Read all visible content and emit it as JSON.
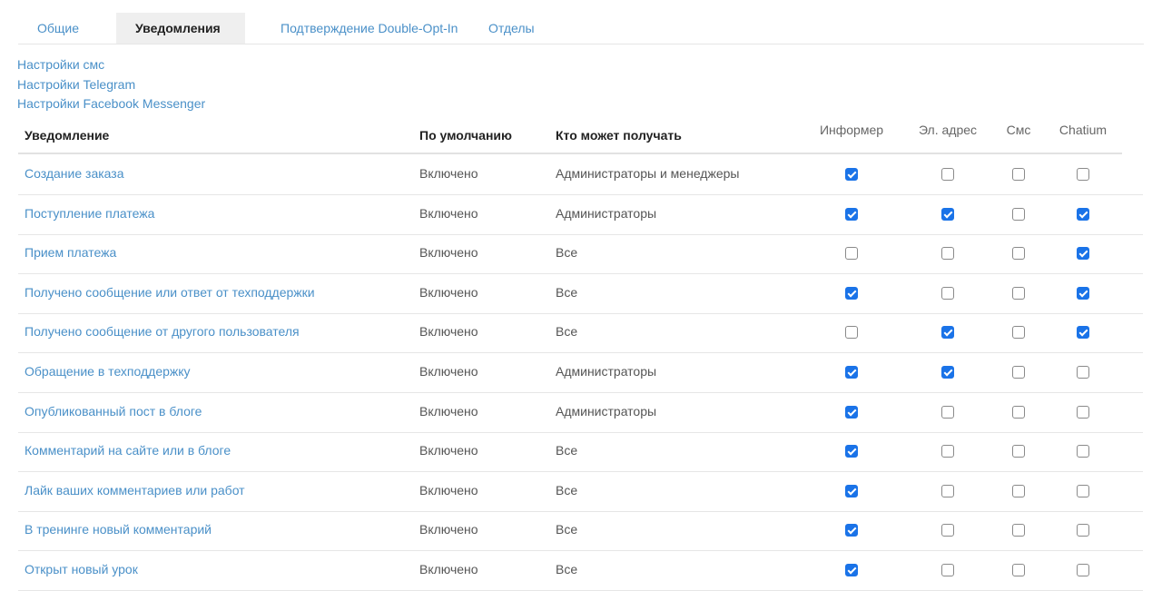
{
  "tabs": [
    {
      "label": "Общие",
      "active": false
    },
    {
      "label": "Уведомления",
      "active": true
    },
    {
      "label": "Подтверждение Double-Opt-In",
      "active": false
    },
    {
      "label": "Отделы",
      "active": false
    }
  ],
  "links": [
    "Настройки смс",
    "Настройки Telegram",
    "Настройки Facebook Messenger"
  ],
  "table": {
    "headers": {
      "name": "Уведомление",
      "default": "По умолчанию",
      "who": "Кто может получать",
      "informer": "Информер",
      "email": "Эл. адрес",
      "sms": "Смс",
      "chatium": "Chatium"
    },
    "rows": [
      {
        "name": "Создание заказа",
        "default": "Включено",
        "who": "Администраторы и менеджеры",
        "checks": [
          true,
          false,
          false,
          false
        ]
      },
      {
        "name": "Поступление платежа",
        "default": "Включено",
        "who": "Администраторы",
        "checks": [
          true,
          true,
          false,
          true
        ]
      },
      {
        "name": "Прием платежа",
        "default": "Включено",
        "who": "Все",
        "checks": [
          false,
          false,
          false,
          true
        ]
      },
      {
        "name": "Получено сообщение или ответ от техподдержки",
        "default": "Включено",
        "who": "Все",
        "checks": [
          true,
          false,
          false,
          true
        ]
      },
      {
        "name": "Получено сообщение от другого пользователя",
        "default": "Включено",
        "who": "Все",
        "checks": [
          false,
          true,
          false,
          true
        ]
      },
      {
        "name": "Обращение в техподдержку",
        "default": "Включено",
        "who": "Администраторы",
        "checks": [
          true,
          true,
          false,
          false
        ]
      },
      {
        "name": "Опубликованный пост в блоге",
        "default": "Включено",
        "who": "Администраторы",
        "checks": [
          true,
          false,
          false,
          false
        ]
      },
      {
        "name": "Комментарий на сайте или в блоге",
        "default": "Включено",
        "who": "Все",
        "checks": [
          true,
          false,
          false,
          false
        ]
      },
      {
        "name": "Лайк ваших комментариев или работ",
        "default": "Включено",
        "who": "Все",
        "checks": [
          true,
          false,
          false,
          false
        ]
      },
      {
        "name": "В тренинге новый комментарий",
        "default": "Включено",
        "who": "Все",
        "checks": [
          true,
          false,
          false,
          false
        ]
      },
      {
        "name": "Открыт новый урок",
        "default": "Включено",
        "who": "Все",
        "checks": [
          true,
          false,
          false,
          false
        ]
      }
    ]
  },
  "colors": {
    "link": "#4a90c8",
    "checkbox_checked": "#1a73e8",
    "active_tab_bg": "#efefef"
  }
}
